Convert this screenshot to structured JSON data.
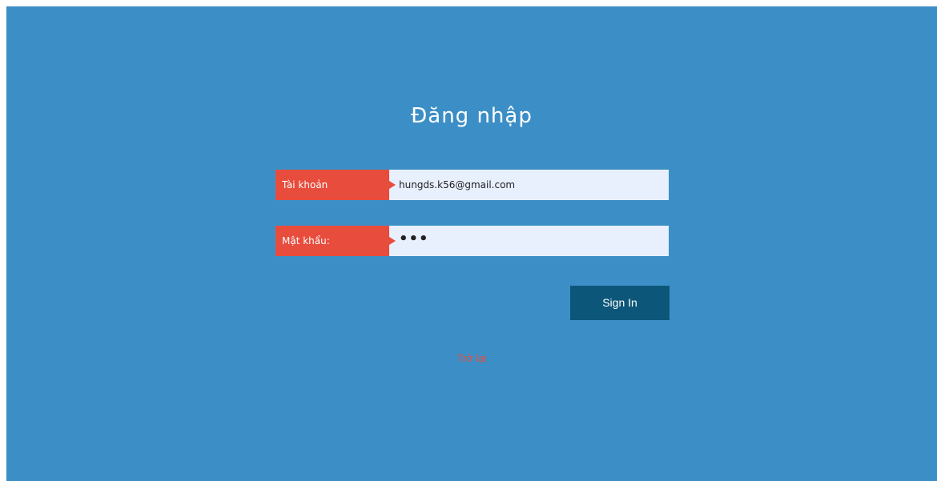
{
  "login": {
    "title": "Đăng nhập",
    "username": {
      "label": "Tài khoản",
      "value": "hungds.k56@gmail.com"
    },
    "password": {
      "label": "Mật khẩu:",
      "masked_value": "•••"
    },
    "submit_label": "Sign In",
    "back_label": "Trở lại"
  },
  "colors": {
    "background": "#3c8fc6",
    "label_bg": "#e74c3c",
    "field_bg": "#e8f0fe",
    "button_bg": "#0c5779",
    "link": "#e74c3c"
  }
}
